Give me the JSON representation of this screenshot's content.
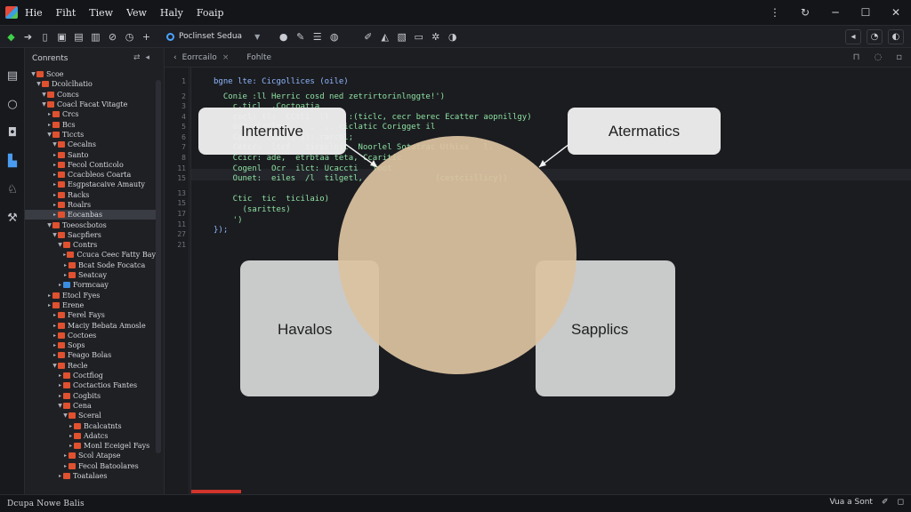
{
  "menubar": {
    "items": [
      "Hie",
      "Fiht",
      "Tiew",
      "Vew",
      "Haly",
      "Foaip"
    ]
  },
  "toolbar": {
    "config_label": "Poclinset Sedua"
  },
  "explorer": {
    "title": "Conrents",
    "tree": [
      {
        "label": "Scoe",
        "depth": 0,
        "open": true,
        "icon": "folder"
      },
      {
        "label": "Dcolclhatio",
        "depth": 1,
        "open": true,
        "icon": "folder"
      },
      {
        "label": "Concs",
        "depth": 2,
        "open": true,
        "icon": "folder"
      },
      {
        "label": "Coacl Facat Vitagte",
        "depth": 2,
        "open": true,
        "icon": "folder"
      },
      {
        "label": "Crcs",
        "depth": 3,
        "open": false,
        "icon": "folder"
      },
      {
        "label": "Bcs",
        "depth": 3,
        "open": false,
        "icon": "folder"
      },
      {
        "label": "Ticcts",
        "depth": 3,
        "open": true,
        "icon": "folder"
      },
      {
        "label": "Cecalns",
        "depth": 4,
        "open": true,
        "icon": "folder"
      },
      {
        "label": "Santo",
        "depth": 4,
        "open": false,
        "icon": "file"
      },
      {
        "label": "Fecol Conticolo",
        "depth": 4,
        "open": false,
        "icon": "file"
      },
      {
        "label": "Ccacbleos Coarta",
        "depth": 4,
        "open": false,
        "icon": "file"
      },
      {
        "label": "Esgpstacaive Amauty",
        "depth": 4,
        "open": false,
        "icon": "file"
      },
      {
        "label": "Racks",
        "depth": 4,
        "open": false,
        "icon": "file"
      },
      {
        "label": "Roalrs",
        "depth": 4,
        "open": false,
        "icon": "file"
      },
      {
        "label": "Eocanbas",
        "depth": 4,
        "open": false,
        "icon": "file",
        "selected": true
      },
      {
        "label": "Toeoscbotos",
        "depth": 3,
        "open": true,
        "icon": "folder"
      },
      {
        "label": "Sacpfiers",
        "depth": 4,
        "open": true,
        "icon": "folder"
      },
      {
        "label": "Contrs",
        "depth": 5,
        "open": true,
        "icon": "folder"
      },
      {
        "label": "Ccuca Ceec Fatty Bay",
        "depth": 6,
        "open": false,
        "icon": "file"
      },
      {
        "label": "Bcat Sode Focatca",
        "depth": 6,
        "open": false,
        "icon": "file"
      },
      {
        "label": "Seatcay",
        "depth": 6,
        "open": false,
        "icon": "file"
      },
      {
        "label": "Formcaay",
        "depth": 5,
        "open": false,
        "icon": "blue"
      },
      {
        "label": "Etocl Fyes",
        "depth": 3,
        "open": false,
        "icon": "folder"
      },
      {
        "label": "Erene",
        "depth": 3,
        "open": false,
        "icon": "folder"
      },
      {
        "label": "Ferel Fays",
        "depth": 4,
        "open": false,
        "icon": "file"
      },
      {
        "label": "Maciy Bebata Amosle",
        "depth": 4,
        "open": false,
        "icon": "file"
      },
      {
        "label": "Coctoes",
        "depth": 4,
        "open": false,
        "icon": "file"
      },
      {
        "label": "Sops",
        "depth": 4,
        "open": false,
        "icon": "file"
      },
      {
        "label": "Feago Bolas",
        "depth": 4,
        "open": false,
        "icon": "file"
      },
      {
        "label": "Recle",
        "depth": 4,
        "open": true,
        "icon": "folder"
      },
      {
        "label": "Coctfiog",
        "depth": 5,
        "open": false,
        "icon": "file"
      },
      {
        "label": "Coctactios Fantes",
        "depth": 5,
        "open": false,
        "icon": "file"
      },
      {
        "label": "Cogbits",
        "depth": 5,
        "open": false,
        "icon": "file"
      },
      {
        "label": "Cena",
        "depth": 5,
        "open": true,
        "icon": "folder"
      },
      {
        "label": "Sceral",
        "depth": 6,
        "open": true,
        "icon": "folder"
      },
      {
        "label": "Bcalcatnts",
        "depth": 7,
        "open": false,
        "icon": "file"
      },
      {
        "label": "Adatcs",
        "depth": 7,
        "open": false,
        "icon": "file"
      },
      {
        "label": "Monl Eceigel Fays",
        "depth": 7,
        "open": false,
        "icon": "file"
      },
      {
        "label": "Scol Atapse",
        "depth": 6,
        "open": false,
        "icon": "file"
      },
      {
        "label": "Fecol Batoolares",
        "depth": 6,
        "open": false,
        "icon": "file"
      },
      {
        "label": "Toatalaes",
        "depth": 5,
        "open": false,
        "icon": "file"
      }
    ]
  },
  "editor": {
    "tabs": [
      {
        "label": "Eorrcailo"
      },
      {
        "label": "Fohlte"
      }
    ],
    "line_numbers": [
      "1",
      "2",
      "3",
      "4",
      "5",
      "6",
      "7",
      "8",
      "11",
      "15",
      "13",
      "15",
      "17",
      "11",
      "27",
      "21"
    ],
    "code_lines": [
      "bgne lte: Cicgollices (oile)",
      "  Conie :ll Herric cosd ned zetrirtorinlnggte!')",
      "    c,ticl  ,Coctoatia",
      "    cocl: tl:  CCtli  ll    :(ticlc, cecr berec Ecatter aopnillgy)",
      "    oce  Crtlc:'    ,  ,, ciclatic Corigget il",
      "    Cocl:  Ccatl( il: rarcbl;",
      "    Cetcr:  ltcf   tirsclnic  Noorlel Sotatrac Uthiss   l.",
      "    Ccicr: ade,  etrbtaa teta, Ccaritic",
      "    Cogenl  Ocr  ilct: Ucaccti   foot",
      "    Ounet:  eiles  /l  tilgetl,               (cestciillicy))",
      "",
      "    Ctic  tic  ticilaio)",
      "      (sarittes)",
      "    ')",
      "});"
    ]
  },
  "diagram": {
    "top_left": "Interntive",
    "top_right": "Atermatics",
    "bottom_left": "Havalos",
    "bottom_right": "Sapplics"
  },
  "statusbar": {
    "left": "Dcupa Nowe Balis",
    "right": "Vua a Sont"
  },
  "colors": {
    "accent_blue": "#4aa3ff",
    "folder_orange": "#e0512f",
    "circle_tan": "#dcc3a0",
    "error_red": "#d0342c"
  }
}
